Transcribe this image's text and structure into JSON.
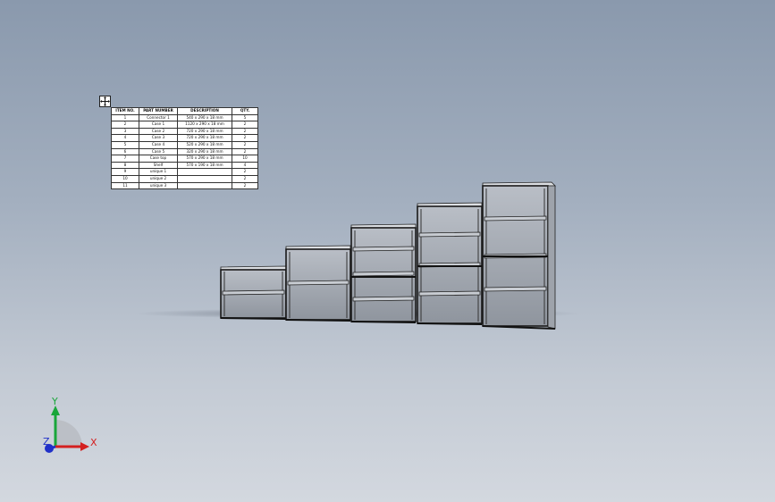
{
  "bom": {
    "headers": [
      "ITEM NO.",
      "PART NUMBER",
      "DESCRIPTION",
      "QTY."
    ],
    "rows": [
      [
        "1",
        "Connector 1",
        "540 x 290 x 18 mm",
        "5"
      ],
      [
        "2",
        "Case 1",
        "1120 x 290 x 18 mm",
        "2"
      ],
      [
        "3",
        "Case 2",
        "720 x 290 x 18 mm",
        "2"
      ],
      [
        "4",
        "Case 3",
        "720 x 290 x 18 mm",
        "2"
      ],
      [
        "5",
        "Case 4",
        "520 x 290 x 18 mm",
        "2"
      ],
      [
        "6",
        "Case 5",
        "320 x 290 x 18 mm",
        "2"
      ],
      [
        "7",
        "Case top",
        "570 x 290 x 18 mm",
        "10"
      ],
      [
        "8",
        "Shelf",
        "570 x 190 x 18 mm",
        "4"
      ],
      [
        "9",
        "unique 1",
        "",
        "2"
      ],
      [
        "10",
        "unique 2",
        "",
        "2"
      ],
      [
        "11",
        "unique 3",
        "",
        "2"
      ]
    ]
  },
  "triad": {
    "x_label": "X",
    "y_label": "Y",
    "z_label": "Z",
    "x_color": "#d42020",
    "y_color": "#19a63a",
    "z_color": "#2030c8"
  },
  "icons": {
    "move_handle": "move-arrows-icon"
  }
}
